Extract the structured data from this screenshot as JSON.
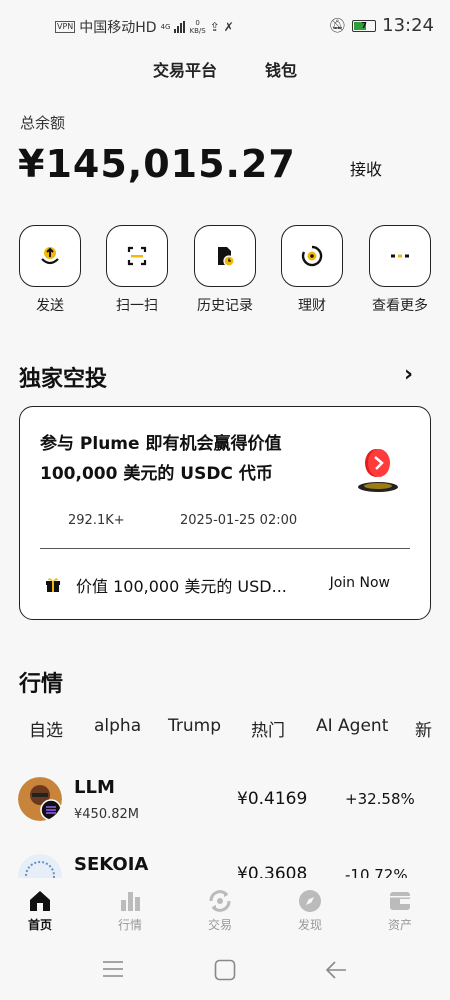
{
  "status_bar": {
    "vpn": "VPN",
    "carrier": "中国移动HD",
    "network": "4G",
    "speed_value": "0",
    "speed_unit": "KB/S",
    "battery": "7",
    "time": "13:24"
  },
  "top_nav": {
    "tabs": [
      "交易平台",
      "钱包"
    ]
  },
  "balance": {
    "label": "总余额",
    "value": "¥145,015.27",
    "receive_label": "接收"
  },
  "actions": [
    {
      "label": "发送",
      "icon": "send-icon"
    },
    {
      "label": "扫一扫",
      "icon": "scan-icon"
    },
    {
      "label": "历史记录",
      "icon": "history-icon"
    },
    {
      "label": "理财",
      "icon": "earn-icon"
    },
    {
      "label": "查看更多",
      "icon": "more-icon"
    }
  ],
  "airdrop": {
    "title": "独家空投",
    "headline": "参与 Plume 即有机会赢得价值 100,000 美元的 USDC 代币",
    "participants": "292.1K+",
    "date": "2025-01-25 02:00",
    "promo_text": "价值 100,000 美元的 USD...",
    "join_label": "Join Now"
  },
  "market": {
    "title": "行情",
    "tabs": [
      "自选",
      "alpha",
      "Trump",
      "热门",
      "AI Agent",
      "新"
    ],
    "rows": [
      {
        "symbol": "LLM",
        "cap": "¥450.82M",
        "price": "¥0.4169",
        "change": "+32.58%"
      },
      {
        "symbol": "SEKOIA",
        "cap": "",
        "price": "¥0.3608",
        "change": "-10.72%"
      }
    ]
  },
  "bottom_nav": {
    "items": [
      {
        "label": "首页",
        "icon": "home-icon",
        "active": true
      },
      {
        "label": "行情",
        "icon": "markets-icon",
        "active": false
      },
      {
        "label": "交易",
        "icon": "trade-icon",
        "active": false
      },
      {
        "label": "发现",
        "icon": "discover-icon",
        "active": false
      },
      {
        "label": "资产",
        "icon": "assets-icon",
        "active": false
      }
    ]
  },
  "colors": {
    "accent": "#f0b90b",
    "text": "#111111",
    "muted": "#999999"
  }
}
